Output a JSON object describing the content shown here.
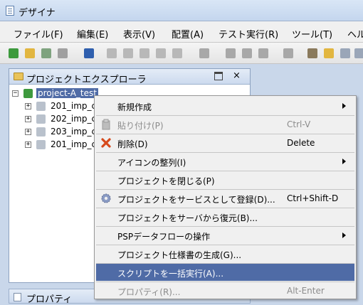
{
  "window": {
    "title": "デザイナ"
  },
  "menubar": {
    "items": [
      {
        "label": "ファイル(F)"
      },
      {
        "label": "編集(E)"
      },
      {
        "label": "表示(V)"
      },
      {
        "label": "配置(A)"
      },
      {
        "label": "テスト実行(R)"
      },
      {
        "label": "ツール(T)"
      },
      {
        "label": "ヘル"
      }
    ]
  },
  "toolbar": {
    "icons": [
      "new-project-icon",
      "open-icon",
      "new-service-icon",
      "tool-icon",
      "save-icon",
      "undo-icon",
      "redo-icon",
      "cut-icon",
      "copy-icon",
      "paste-icon",
      "search-icon",
      "debug-icon",
      "run-icon",
      "stop-icon",
      "window-icon",
      "wrench-icon",
      "folder-icon",
      "document-icon",
      "list-icon"
    ]
  },
  "explorer": {
    "title": "プロジェクトエクスプローラ",
    "tree": {
      "root": {
        "label": "project-A_test",
        "expander": "−"
      },
      "children": [
        {
          "label": "201_imp_c",
          "expander": "+"
        },
        {
          "label": "202_imp_c",
          "expander": "+"
        },
        {
          "label": "203_imp_c",
          "expander": "+"
        },
        {
          "label": "201_imp_c",
          "expander": "+"
        }
      ]
    }
  },
  "properties": {
    "title": "プロパティ"
  },
  "context_menu": {
    "items": [
      {
        "label": "新規作成",
        "shortcut": "",
        "submenu": true,
        "disabled": false,
        "selected": false
      },
      {
        "label": "貼り付け(P)",
        "shortcut": "Ctrl-V",
        "submenu": false,
        "disabled": true,
        "selected": false,
        "icon": "paste-icon"
      },
      {
        "label": "削除(D)",
        "shortcut": "Delete",
        "submenu": false,
        "disabled": false,
        "selected": false,
        "icon": "delete-icon"
      },
      {
        "label": "アイコンの整列(I)",
        "shortcut": "",
        "submenu": true,
        "disabled": false,
        "selected": false
      },
      {
        "label": "プロジェクトを閉じる(P)",
        "shortcut": "",
        "submenu": false,
        "disabled": false,
        "selected": false
      },
      {
        "label": "プロジェクトをサービスとして登録(D)...",
        "shortcut": "Ctrl+Shift-D",
        "submenu": false,
        "disabled": false,
        "selected": false,
        "icon": "gear-icon"
      },
      {
        "label": "プロジェクトをサーバから復元(B)...",
        "shortcut": "",
        "submenu": false,
        "disabled": false,
        "selected": false
      },
      {
        "label": "PSPデータフローの操作",
        "shortcut": "",
        "submenu": true,
        "disabled": false,
        "selected": false
      },
      {
        "label": "プロジェクト仕様書の生成(G)...",
        "shortcut": "",
        "submenu": false,
        "disabled": false,
        "selected": false
      },
      {
        "label": "スクリプトを一括実行(A)...",
        "shortcut": "",
        "submenu": false,
        "disabled": false,
        "selected": true
      },
      {
        "label": "プロパティ(R)...",
        "shortcut": "Alt-Enter",
        "submenu": false,
        "disabled": true,
        "selected": false
      }
    ]
  }
}
